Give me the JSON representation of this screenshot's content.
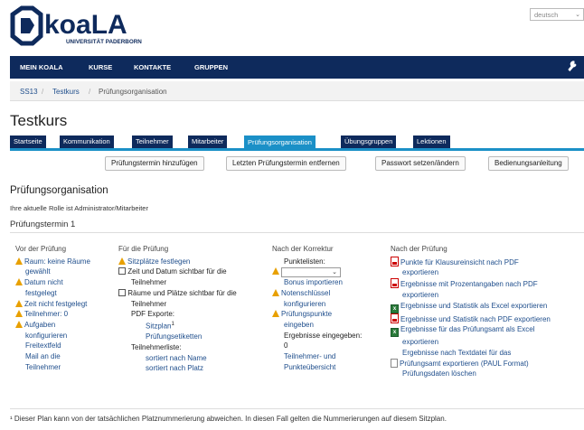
{
  "header": {
    "logo_text": "koaLA",
    "logo_sub": "UNIVERSITÄT PADERBORN",
    "language": "deutsch"
  },
  "nav": {
    "items": [
      "MEIN KOALA",
      "KURSE",
      "KONTAKTE",
      "GRUPPEN"
    ]
  },
  "breadcrumb": [
    "SS13",
    "Testkurs",
    "Prüfungsorganisation"
  ],
  "page": {
    "title": "Testkurs"
  },
  "tabs": [
    "Startseite",
    "Kommunikation",
    "Teilnehmer",
    "Mitarbeiter",
    "Prüfungsorganisation",
    "Übungsgruppen",
    "Lektionen"
  ],
  "active_tab": "Prüfungsorganisation",
  "actions": [
    "Prüfungstermin hinzufügen",
    "Letzten Prüfungstermin entfernen",
    "Passwort setzen/ändern",
    "Bedienungsanleitung"
  ],
  "section": {
    "title": "Prüfungsorganisation",
    "role": "Ihre aktuelle Rolle ist Administrator/Mitarbeiter",
    "termin": "Prüfungstermin 1"
  },
  "col1": {
    "heading": "Vor der Prüfung",
    "l1": "Raum: keine Räume",
    "l2": "gewählt",
    "l3": "Datum nicht",
    "l4": "festgelegt",
    "l5": "Zeit nicht festgelegt",
    "l6": "Teilnehmer: 0",
    "l7": "Aufgaben",
    "l8": "konfigurieren",
    "l9": "Freitextfeld",
    "l10": "Mail an die",
    "l11": "Teilnehmer"
  },
  "col2": {
    "heading": "Für die Prüfung",
    "l1": "Sitzplätze festlegen",
    "l2": "Zeit und Datum sichtbar für die",
    "l3": "Teilnehmer",
    "l4": "Räume und Plätze sichtbar für die",
    "l5": "Teilnehmer",
    "l6": "PDF Exporte:",
    "l7": "Sitzplan",
    "l7sup": "1",
    "l8": "Prüfungsetiketten",
    "l9": "Teilnehmerliste:",
    "l10": "sortiert nach Name",
    "l11": "sortiert nach Platz"
  },
  "col3": {
    "heading": "Nach der Korrektur",
    "l1": "Punktelisten:",
    "l2": "Bonus importieren",
    "l3": "Notenschlüssel",
    "l4": "konfigurieren",
    "l5": "Prüfungspunkte",
    "l6": "eingeben",
    "l7": "Ergebnisse eingegeben:",
    "l8": "0",
    "l9": "Teilnehmer- und",
    "l10": "Punkteübersicht"
  },
  "col4": {
    "heading": "Nach der Prüfung",
    "l1": "Punkte für Klausureinsicht nach PDF",
    "l2": "exportieren",
    "l3": "Ergebnisse mit Prozentangaben nach PDF",
    "l4": "exportieren",
    "l5": "Ergebnisse und Statistik als Excel exportieren",
    "l6": "Ergebnisse und Statistik nach PDF exportieren",
    "l7": "Ergebnisse für das Prüfungsamt als Excel",
    "l8": "exportieren",
    "l9": "Ergebnisse nach Textdatei für das",
    "l10": "Prüfungsamt exportieren (PAUL Format)",
    "l11": "Prüfungsdaten löschen"
  },
  "footnote": "¹ Dieser Plan kann von der tatsächlichen Platznummerierung abweichen. In diesen Fall gelten die Nummerierungen auf diesem Sitzplan.",
  "colors": {
    "nav": "#0e2a5c",
    "accent": "#1b90c7",
    "link": "#1f4e8c",
    "warning": "#e8a000"
  }
}
